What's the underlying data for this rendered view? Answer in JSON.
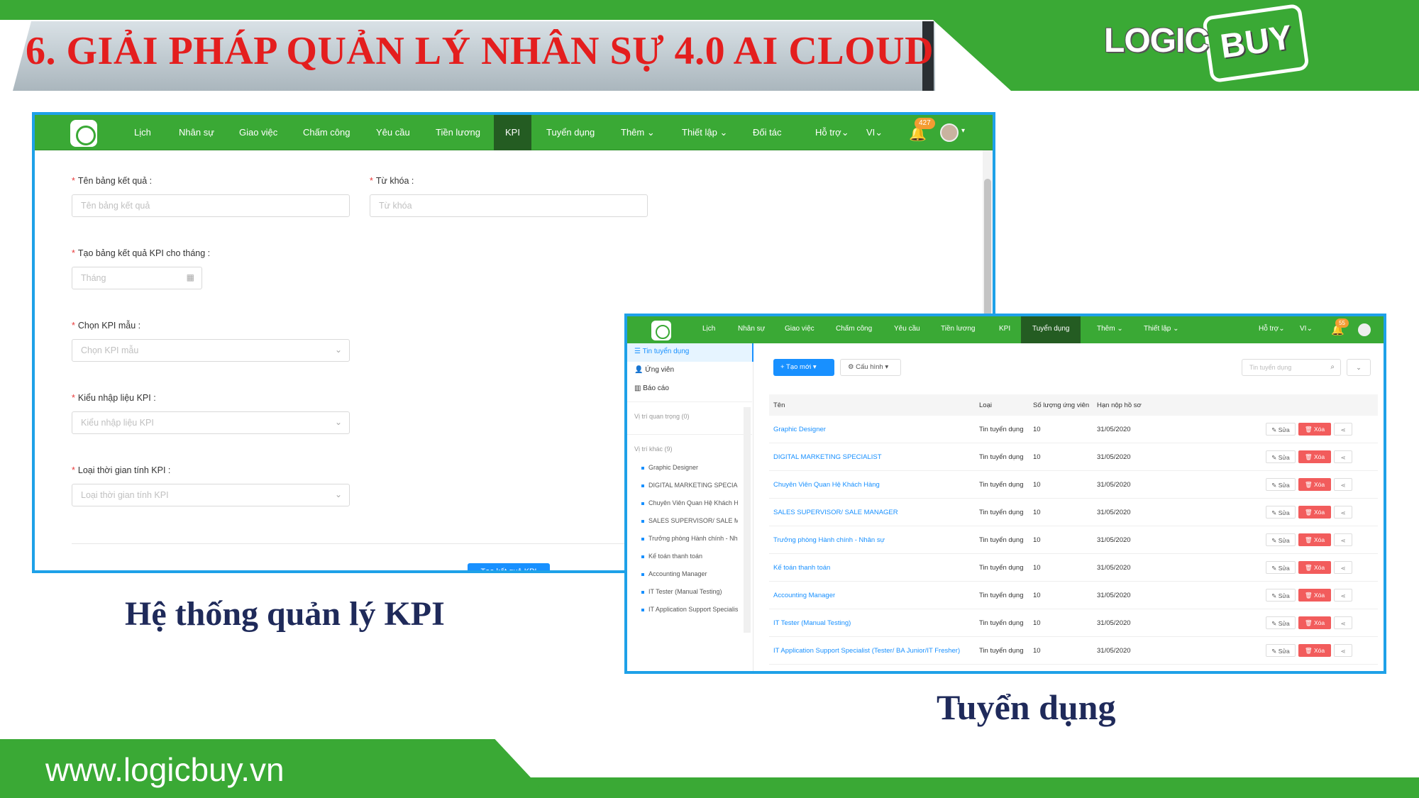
{
  "slide": {
    "title": "6. GIẢI PHÁP QUẢN LÝ NHÂN SỰ 4.0 AI CLOUD",
    "logo_left": "LOGIC",
    "logo_right": "BUY",
    "website": "www.logicbuy.vn",
    "caption_kpi": "Hệ thống quản lý KPI",
    "caption_recruit": "Tuyển dụng",
    "brand_green": "#3aa935",
    "title_red": "#e41e1e"
  },
  "kpi_app": {
    "nav": {
      "items": [
        "Lịch",
        "Nhân sự",
        "Giao việc",
        "Chấm công",
        "Yêu cầu",
        "Tiền lương",
        "KPI",
        "Tuyển dụng",
        "Thêm",
        "Thiết lập",
        "Đối tác",
        "Hỗ trợ",
        "VI"
      ],
      "active": "KPI",
      "notification_count": "427"
    },
    "form": {
      "result_name_label": "Tên bảng kết quả :",
      "result_name_placeholder": "Tên bảng kết quả",
      "keyword_label": "Từ khóa :",
      "keyword_placeholder": "Từ khóa",
      "month_label": "Tạo bảng kết quả KPI cho tháng :",
      "month_placeholder": "Tháng",
      "template_label": "Chọn KPI mẫu :",
      "template_placeholder": "Chọn KPI mẫu",
      "input_type_label": "Kiểu nhập liệu KPI :",
      "input_type_placeholder": "Kiểu nhập liệu KPI",
      "time_type_label": "Loại thời gian tính KPI :",
      "time_type_placeholder": "Loại thời gian tính KPI",
      "submit_label": "Tạo kết quả KPI"
    }
  },
  "recruit_app": {
    "nav": {
      "items": [
        "Lịch",
        "Nhân sự",
        "Giao việc",
        "Chấm công",
        "Yêu cầu",
        "Tiền lương",
        "KPI",
        "Tuyển dụng",
        "Thêm",
        "Thiết lập",
        "Hỗ trợ",
        "VI"
      ],
      "active": "Tuyển dụng",
      "notification_count": "55"
    },
    "sidebar": {
      "menu": [
        "Tin tuyển dụng",
        "Ứng viên",
        "Báo cáo"
      ],
      "group_important": "Vị trí quan trọng (0)",
      "group_other": "Vị trí khác (9)",
      "positions": [
        "Graphic Designer",
        "DIGITAL MARKETING SPECIALIST",
        "Chuyên Viên Quan Hệ Khách Hàng",
        "SALES SUPERVISOR/ SALE MANAGER",
        "Trưởng phòng Hành chính - Nhân sự",
        "Kế toán thanh toán",
        "Accounting Manager",
        "IT Tester (Manual Testing)",
        "IT Application Support Specialist"
      ]
    },
    "toolbar": {
      "new_label": "Tạo mới",
      "config_label": "Cấu hình",
      "search_placeholder": "Tin tuyển dụng"
    },
    "table": {
      "headers": [
        "Tên",
        "Loại",
        "Số lượng ứng viên",
        "Hạn nộp hồ sơ"
      ],
      "rows": [
        {
          "title": "Graphic Designer",
          "type": "Tin tuyển dụng",
          "count": "10",
          "deadline": "31/05/2020"
        },
        {
          "title": "DIGITAL MARKETING SPECIALIST",
          "type": "Tin tuyển dụng",
          "count": "10",
          "deadline": "31/05/2020"
        },
        {
          "title": "Chuyên Viên Quan Hệ Khách Hàng",
          "type": "Tin tuyển dụng",
          "count": "10",
          "deadline": "31/05/2020"
        },
        {
          "title": "SALES SUPERVISOR/ SALE MANAGER",
          "type": "Tin tuyển dụng",
          "count": "10",
          "deadline": "31/05/2020"
        },
        {
          "title": "Trưởng phòng Hành chính - Nhân sự",
          "type": "Tin tuyển dụng",
          "count": "10",
          "deadline": "31/05/2020"
        },
        {
          "title": "Kế toán thanh toán",
          "type": "Tin tuyển dụng",
          "count": "10",
          "deadline": "31/05/2020"
        },
        {
          "title": "Accounting Manager",
          "type": "Tin tuyển dụng",
          "count": "10",
          "deadline": "31/05/2020"
        },
        {
          "title": "IT Tester (Manual Testing)",
          "type": "Tin tuyển dụng",
          "count": "10",
          "deadline": "31/05/2020"
        },
        {
          "title": "IT Application Support Specialist (Tester/ BA Junior/IT Fresher)",
          "type": "Tin tuyển dụng",
          "count": "10",
          "deadline": "31/05/2020"
        }
      ],
      "edit_label": "Sửa",
      "delete_label": "Xóa"
    }
  }
}
